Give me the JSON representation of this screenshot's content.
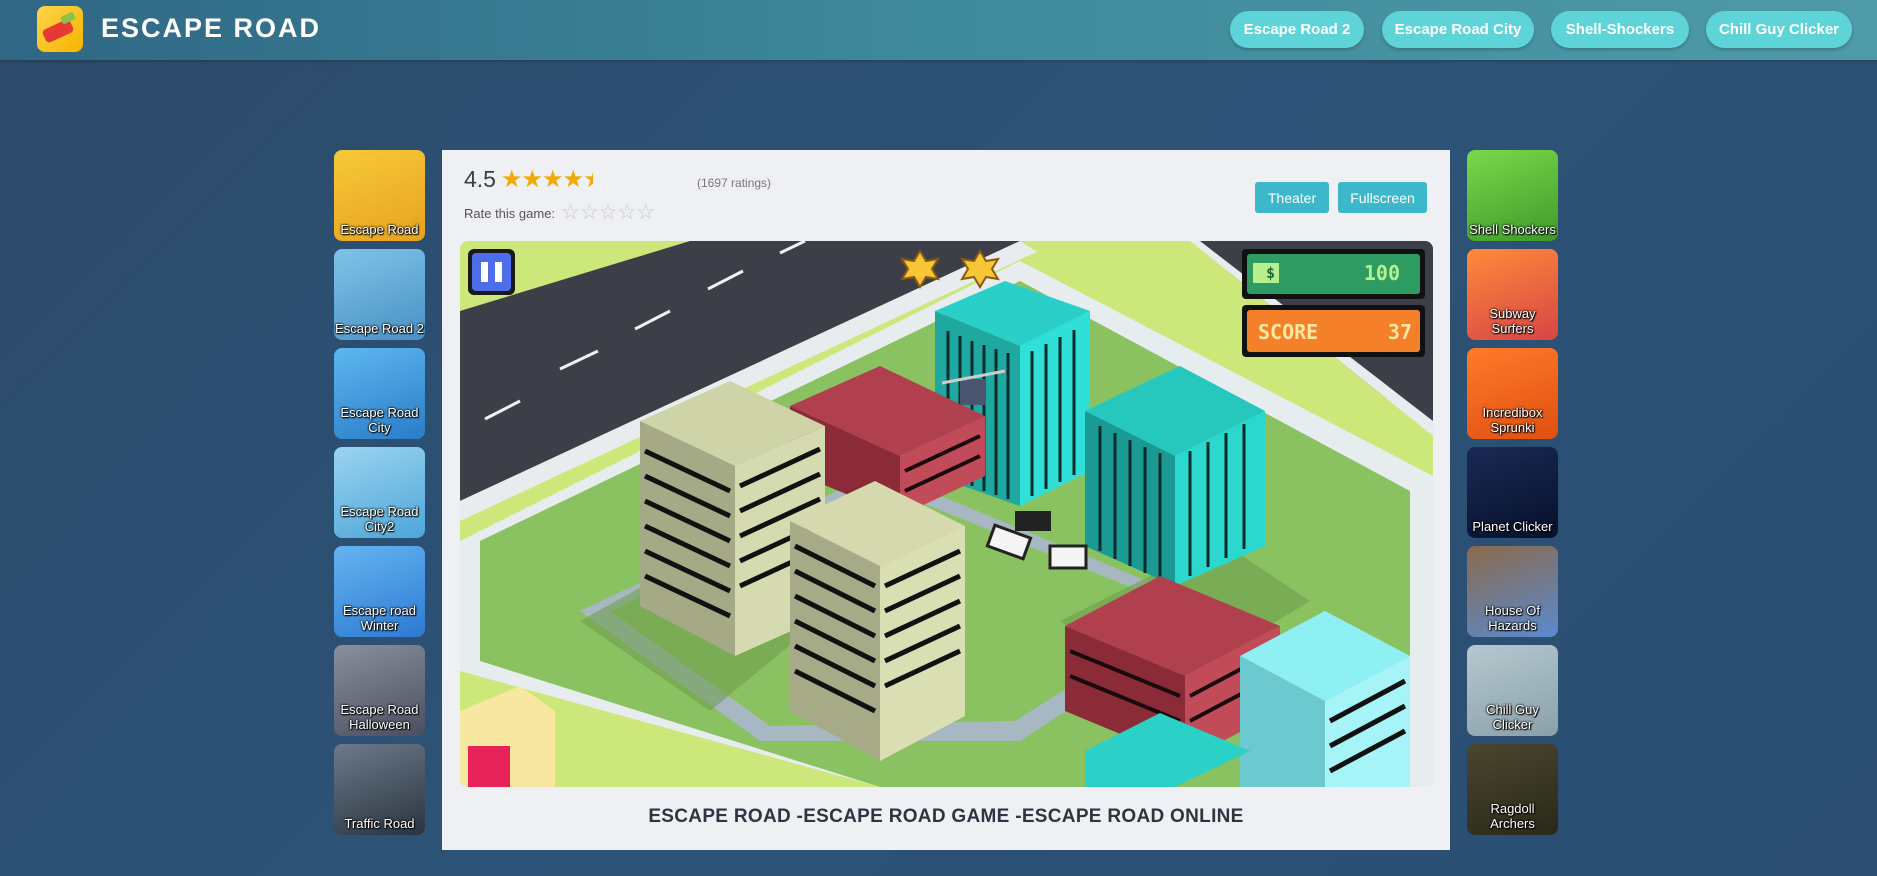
{
  "header": {
    "title": "ESCAPE ROAD",
    "nav": [
      "Escape Road 2",
      "Escape Road City",
      "Shell-Shockers",
      "Chill Guy Clicker"
    ]
  },
  "left_games": [
    {
      "label": "Escape Road",
      "color1": "#f6c93a",
      "color2": "#e8a21d"
    },
    {
      "label": "Escape Road 2",
      "color1": "#7ec4e8",
      "color2": "#4a90c4"
    },
    {
      "label": "Escape Road City",
      "color1": "#5db7ef",
      "color2": "#2a7cc8"
    },
    {
      "label": "Escape Road City2",
      "color1": "#9ad3f0",
      "color2": "#4da6d9"
    },
    {
      "label": "Escape road Winter",
      "color1": "#65b4f0",
      "color2": "#2d7ad3"
    },
    {
      "label": "Escape Road Halloween",
      "color1": "#8a8f9c",
      "color2": "#4a4f60"
    },
    {
      "label": "Traffic Road",
      "color1": "#6d7a8a",
      "color2": "#2a3440"
    }
  ],
  "right_games": [
    {
      "label": "Shell Shockers",
      "color1": "#7ad84a",
      "color2": "#3e9a2a"
    },
    {
      "label": "Subway Surfers",
      "color1": "#ff8a3a",
      "color2": "#d64545"
    },
    {
      "label": "Incredibox Sprunki",
      "color1": "#ff7a2a",
      "color2": "#e05010"
    },
    {
      "label": "Planet Clicker",
      "color1": "#1a2a55",
      "color2": "#06102a"
    },
    {
      "label": "House Of Hazards",
      "color1": "#8a6a4a",
      "color2": "#5a8ad0"
    },
    {
      "label": "Chill Guy Clicker",
      "color1": "#b5c8cf",
      "color2": "#8aa0a8"
    },
    {
      "label": "Ragdoll Archers",
      "color1": "#4a4630",
      "color2": "#2a2818"
    }
  ],
  "rating": {
    "score": "4.5",
    "stars": "★★★★",
    "half_star": "★",
    "count": "(1697 ratings)",
    "rate_label": "Rate this game:",
    "rate_stars": "☆☆☆☆☆"
  },
  "buttons": {
    "theater": "Theater",
    "fullscreen": "Fullscreen"
  },
  "game": {
    "money_icon": "$",
    "money": "100",
    "score_label": "SCORE",
    "score": "37"
  },
  "caption": "ESCAPE ROAD -ESCAPE ROAD GAME -ESCAPE ROAD ONLINE"
}
